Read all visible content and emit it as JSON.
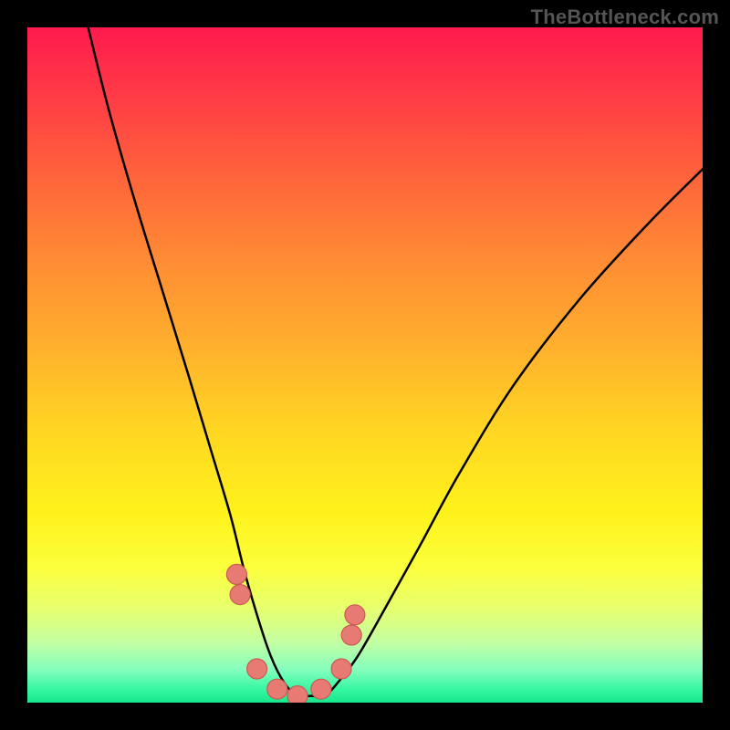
{
  "attribution": "TheBottleneck.com",
  "colors": {
    "frame": "#000000",
    "marker_fill": "#e77b74",
    "marker_stroke": "#c95a53",
    "curve": "#000000"
  },
  "chart_data": {
    "type": "line",
    "title": "",
    "xlabel": "",
    "ylabel": "",
    "xlim": [
      0,
      100
    ],
    "ylim": [
      0,
      100
    ],
    "grid": false,
    "legend": false,
    "note": "Values are estimated from pixel positions; the image has no numeric axis labels. y ≈ bottleneck percentage (0 at bottom/green, 100 at top/red). x ≈ relative hardware balance axis.",
    "series": [
      {
        "name": "bottleneck-curve",
        "x": [
          9,
          12,
          16,
          20,
          24,
          27,
          30,
          32,
          34,
          36,
          38,
          40,
          42,
          44,
          46,
          49,
          53,
          58,
          64,
          72,
          82,
          92,
          100
        ],
        "values": [
          100,
          88,
          74,
          61,
          48,
          38,
          28,
          20,
          13,
          7,
          3,
          1,
          1,
          1,
          3,
          7,
          14,
          23,
          34,
          47,
          60,
          71,
          79
        ]
      }
    ],
    "markers": {
      "name": "highlighted-points",
      "x": [
        31,
        31.5,
        34,
        37,
        40,
        43.5,
        46.5,
        48,
        48.5
      ],
      "values": [
        19,
        16,
        5,
        2,
        1,
        2,
        5,
        10,
        13
      ]
    }
  }
}
